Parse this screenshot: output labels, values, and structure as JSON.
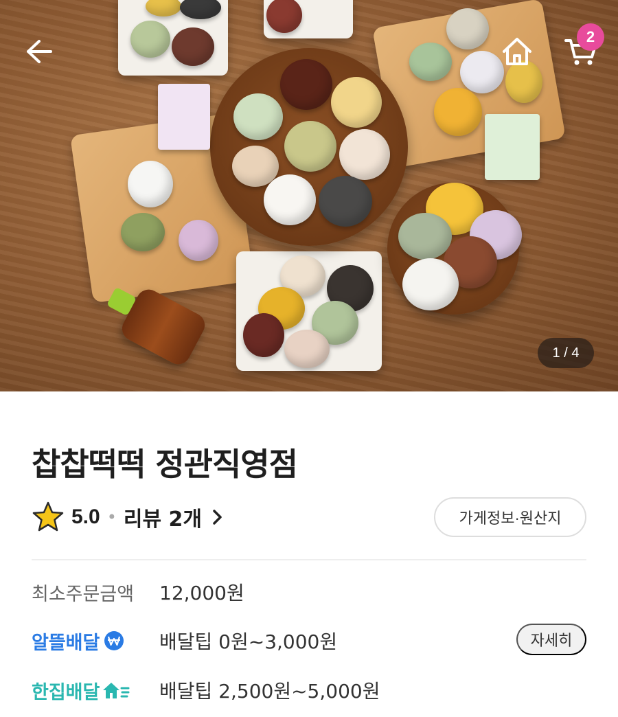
{
  "header": {
    "cart_count": "2",
    "image_counter": "1 / 4"
  },
  "store": {
    "name": "찹찹떡떡 정관직영점",
    "rating": "5.0",
    "review_label": "리뷰 2개",
    "info_button": "가게정보·원산지"
  },
  "order_info": {
    "min_order_label": "최소주문금액",
    "min_order_value": "12,000원",
    "save_delivery_label": "알뜰배달",
    "save_delivery_value": "배달팁 0원~3,000원",
    "detail_button": "자세히",
    "single_delivery_label": "한집배달",
    "single_delivery_value": "배달팁 2,500원~5,000원"
  },
  "colors": {
    "badge": "#e84b9c",
    "save_delivery": "#2a7be4",
    "single_delivery": "#2ab7b0",
    "star": "#f5c518"
  },
  "icons": [
    "back-arrow-icon",
    "home-icon",
    "cart-icon",
    "star-icon",
    "chevron-right-icon",
    "won-icon",
    "house-icon"
  ]
}
